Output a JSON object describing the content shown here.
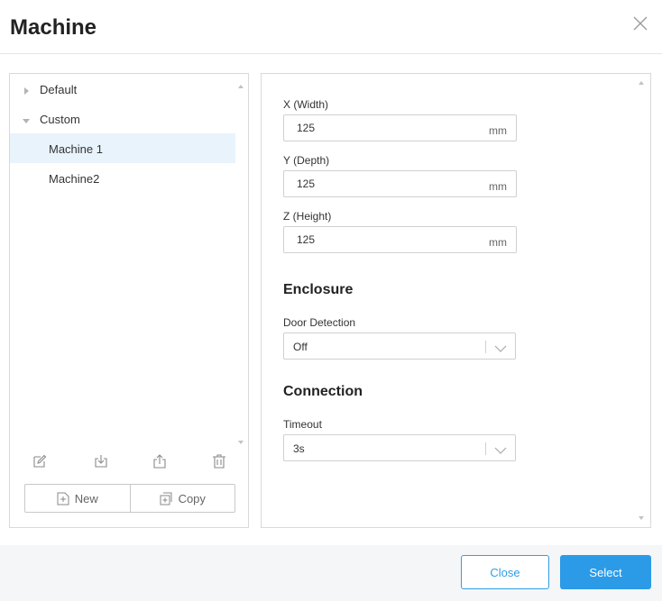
{
  "dialog": {
    "title": "Machine",
    "close_icon": "close-icon"
  },
  "tree": {
    "items": [
      {
        "label": "Default",
        "expanded": false,
        "selected": false,
        "level": 0
      },
      {
        "label": "Custom",
        "expanded": true,
        "selected": false,
        "level": 0
      },
      {
        "label": "Machine 1",
        "selected": true,
        "level": 1
      },
      {
        "label": "Machine2",
        "selected": false,
        "level": 1
      }
    ]
  },
  "toolbar": {
    "icons": [
      "edit-icon",
      "import-icon",
      "export-icon",
      "delete-icon"
    ],
    "new_label": "New",
    "copy_label": "Copy"
  },
  "dimensions": {
    "x_label": "X (Width)",
    "x_value": "125",
    "y_label": "Y (Depth)",
    "y_value": "125",
    "z_label": "Z (Height)",
    "z_value": "125",
    "unit": "mm"
  },
  "enclosure": {
    "title": "Enclosure",
    "door_label": "Door Detection",
    "door_value": "Off"
  },
  "connection": {
    "title": "Connection",
    "timeout_label": "Timeout",
    "timeout_value": "3s"
  },
  "footer": {
    "close_label": "Close",
    "select_label": "Select"
  },
  "colors": {
    "accent": "#2b9be8",
    "selected_row": "#e8f3fc",
    "footer_bg": "#f5f6f8"
  }
}
